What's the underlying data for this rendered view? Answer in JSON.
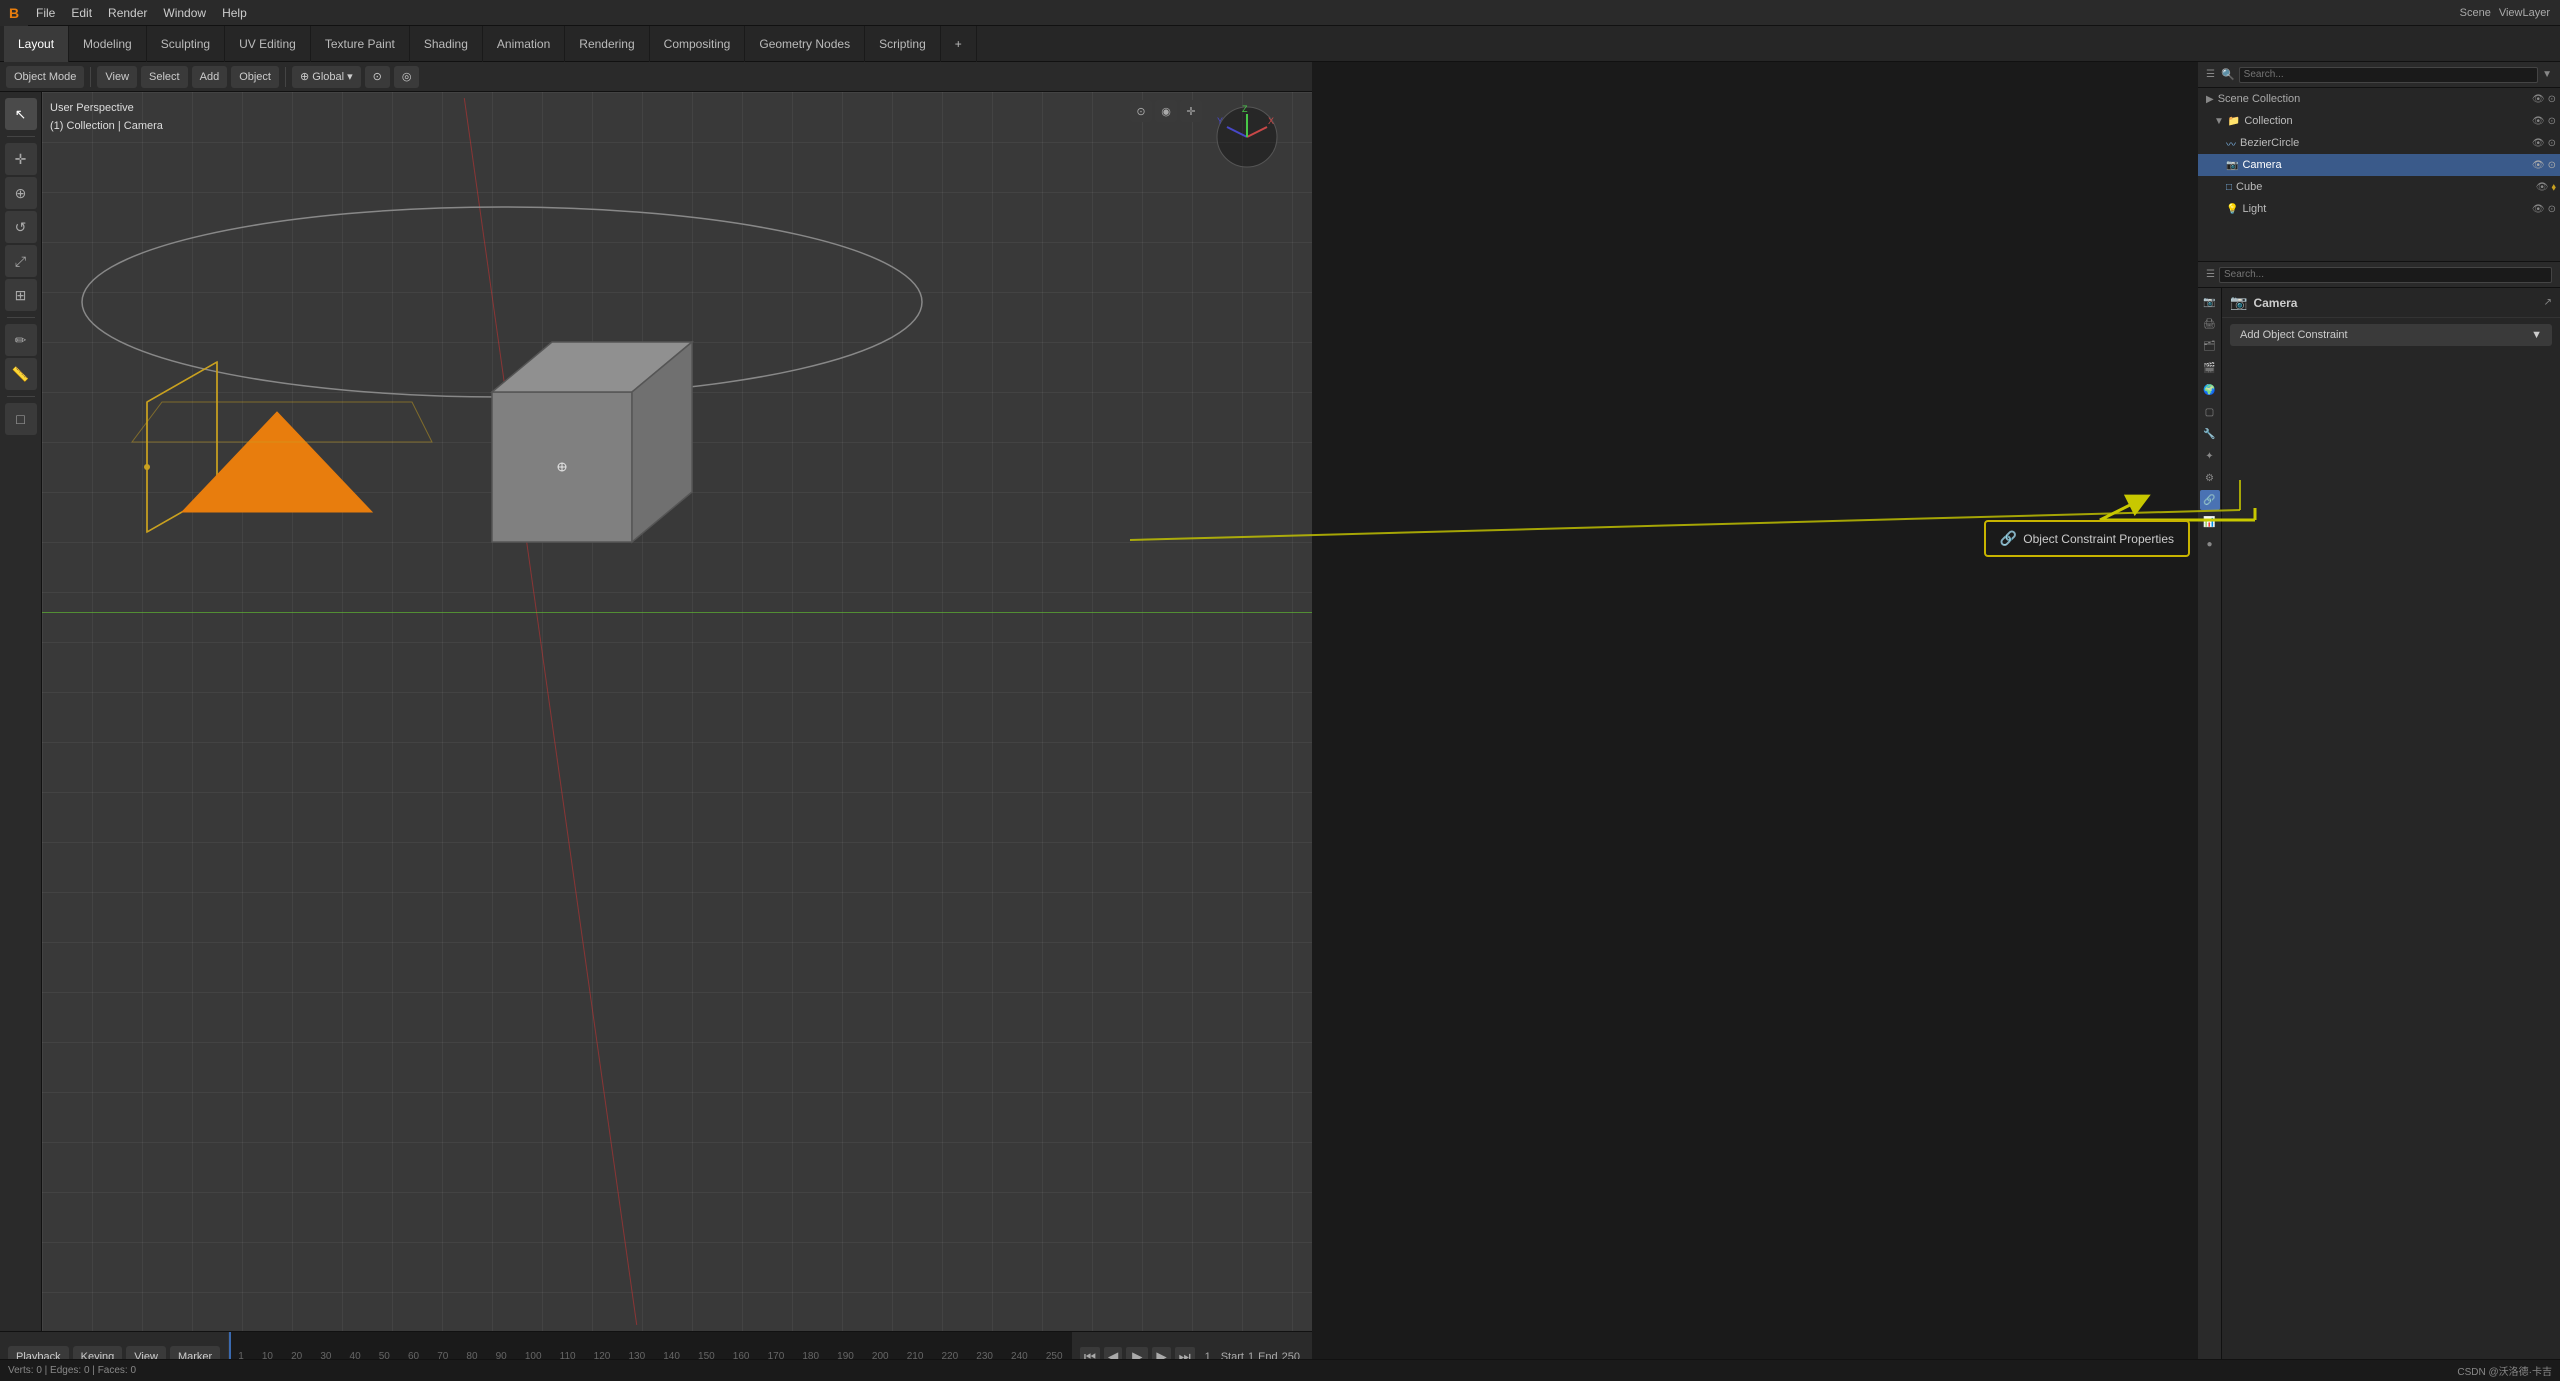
{
  "app": {
    "title": "Blender",
    "logo": "B"
  },
  "top_menu": {
    "items": [
      "Blender",
      "File",
      "Edit",
      "Render",
      "Window",
      "Help"
    ]
  },
  "workspace_tabs": {
    "tabs": [
      "Layout",
      "Modeling",
      "Sculpting",
      "UV Editing",
      "Texture Paint",
      "Shading",
      "Animation",
      "Rendering",
      "Compositing",
      "Geometry Nodes",
      "Scripting",
      "+"
    ],
    "active": "Layout"
  },
  "viewport": {
    "mode": "Object Mode",
    "view": "User Perspective",
    "collection": "(1) Collection | Camera",
    "transform": "Global"
  },
  "right_panel": {
    "title": "Scene",
    "view_layer": "ViewLayer"
  },
  "outliner": {
    "title": "Scene Collection",
    "items": [
      {
        "label": "Collection",
        "level": 0,
        "icon": "▶",
        "type": "collection"
      },
      {
        "label": "BezierCircle",
        "level": 1,
        "icon": "○",
        "type": "curve"
      },
      {
        "label": "Camera",
        "level": 1,
        "icon": "📷",
        "type": "camera",
        "active": true
      },
      {
        "label": "Cube",
        "level": 1,
        "icon": "□",
        "type": "mesh"
      },
      {
        "label": "Light",
        "level": 1,
        "icon": "💡",
        "type": "light"
      }
    ]
  },
  "properties": {
    "active_object": "Camera",
    "add_constraint_label": "Add Object Constraint",
    "tabs": [
      "scene",
      "render",
      "output",
      "view_layer",
      "scene2",
      "world",
      "object",
      "modifiers",
      "particles",
      "physics",
      "constraints",
      "data",
      "material"
    ],
    "active_tab": "constraints"
  },
  "tooltip": {
    "label": "Object Constraint Properties",
    "icon": "🔗"
  },
  "timeline": {
    "playback_label": "Playback",
    "keying_label": "Keying",
    "view_label": "View",
    "marker_label": "Marker",
    "frame_start": "1",
    "frame_current": "1",
    "frame_start_label": "Start",
    "frame_end_label": "End",
    "frame_end": "250",
    "frame_numbers": [
      "1",
      "10",
      "20",
      "30",
      "40",
      "50",
      "60",
      "70",
      "80",
      "90",
      "100",
      "110",
      "120",
      "130",
      "140",
      "150",
      "160",
      "170",
      "180",
      "190",
      "200",
      "210",
      "220",
      "230",
      "240",
      "250"
    ]
  },
  "status_bar": {
    "vertices": "0",
    "text": ""
  }
}
